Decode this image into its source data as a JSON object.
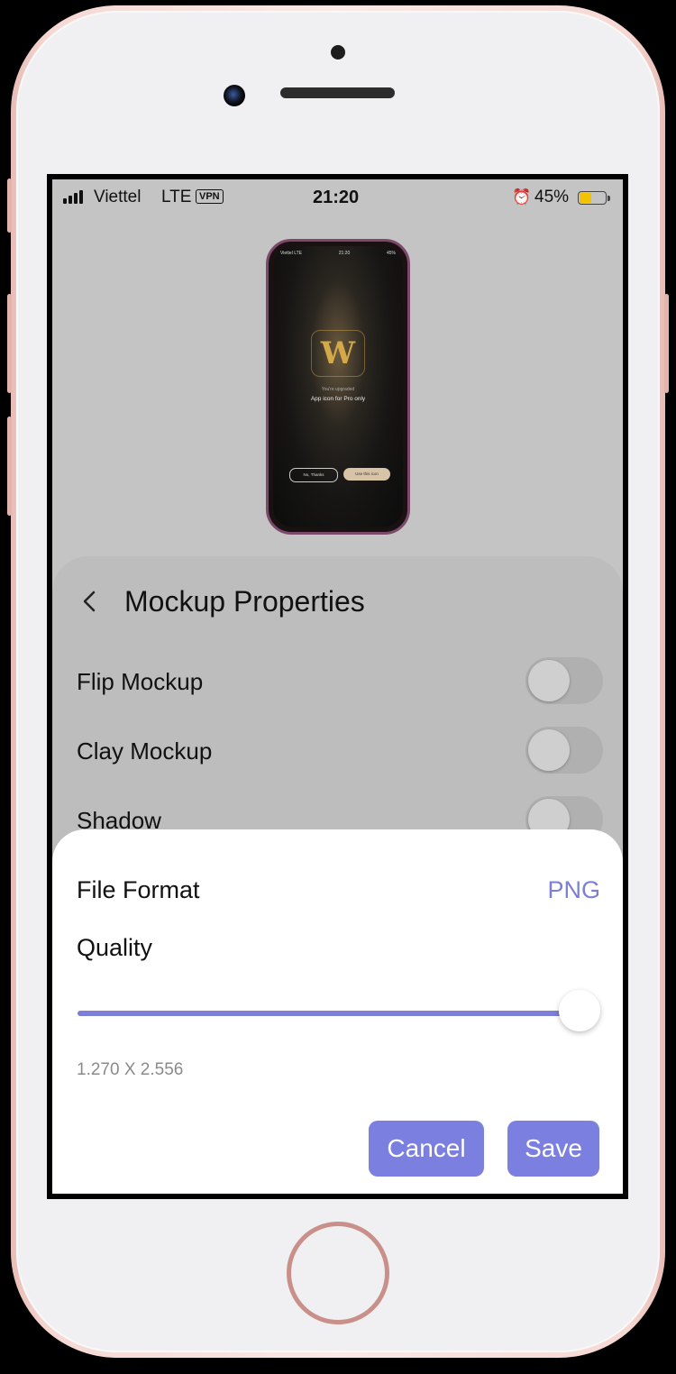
{
  "status_bar": {
    "carrier": "Viettel",
    "network": "LTE",
    "vpn": "VPN",
    "time": "21:20",
    "alarm_icon": "alarm-clock-icon",
    "battery_percent": "45%",
    "battery_level": 0.45,
    "battery_color": "#f3c200"
  },
  "preview": {
    "status_left": "Viettel LTE",
    "status_time": "21:20",
    "status_right": "45%",
    "line1": "You're upgraded",
    "line2": "App icon for Pro only",
    "button_left": "No, Thanks",
    "button_right": "Use this icon"
  },
  "properties": {
    "title": "Mockup Properties",
    "back_icon": "chevron-left-icon",
    "items": [
      {
        "label": "Flip Mockup",
        "enabled": false
      },
      {
        "label": "Clay Mockup",
        "enabled": false
      },
      {
        "label": "Shadow",
        "enabled": false
      }
    ]
  },
  "export_sheet": {
    "format_label": "File Format",
    "format_value": "PNG",
    "quality_label": "Quality",
    "quality_value": 1.0,
    "dimensions": "1.270 X 2.556",
    "cancel_label": "Cancel",
    "save_label": "Save",
    "accent_color": "#7b7fe0"
  }
}
